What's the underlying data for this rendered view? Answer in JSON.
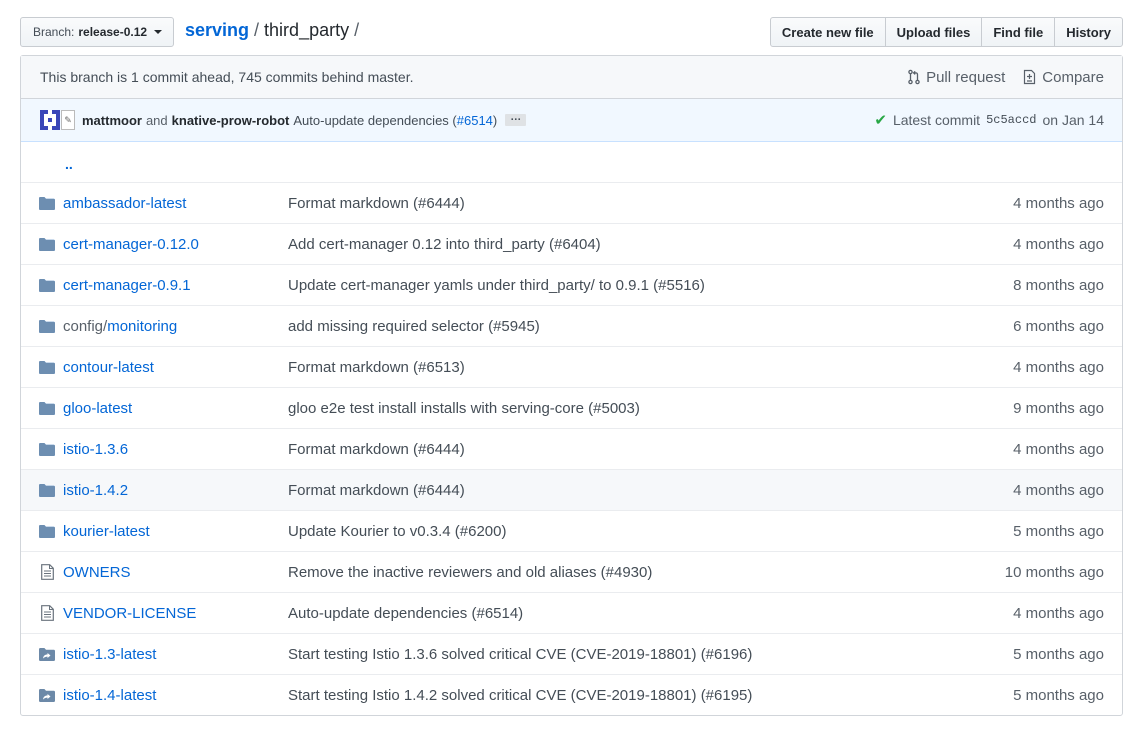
{
  "branch": {
    "prefix": "Branch:",
    "name": "release-0.12"
  },
  "breadcrumb": {
    "repo": "serving",
    "sep1": "/",
    "dir": "third_party",
    "sep2": "/"
  },
  "file_nav": {
    "create": "Create new file",
    "upload": "Upload files",
    "find": "Find file",
    "history": "History"
  },
  "branch_info": {
    "text": "This branch is 1 commit ahead, 745 commits behind master.",
    "pull_request": "Pull request",
    "compare": "Compare"
  },
  "commit": {
    "author1": "mattmoor",
    "and": "and",
    "author2": "knative-prow-robot",
    "message": "Auto-update dependencies (",
    "pr": "#6514",
    "message_end": ")",
    "ellipsis": "…",
    "latest_label": "Latest commit",
    "sha": "5c5accd",
    "date": "on Jan 14"
  },
  "parent_link": "..",
  "files": [
    {
      "type": "folder",
      "prefix": "",
      "name": "ambassador-latest",
      "message": "Format markdown (#6444)",
      "age": "4 months ago"
    },
    {
      "type": "folder",
      "prefix": "",
      "name": "cert-manager-0.12.0",
      "message": "Add cert-manager 0.12 into third_party (#6404)",
      "age": "4 months ago"
    },
    {
      "type": "folder",
      "prefix": "",
      "name": "cert-manager-0.9.1",
      "message": "Update cert-manager yamls under third_party/ to 0.9.1 (#5516)",
      "age": "8 months ago"
    },
    {
      "type": "folder",
      "prefix": "config/",
      "name": "monitoring",
      "message": "add missing required selector (#5945)",
      "age": "6 months ago"
    },
    {
      "type": "folder",
      "prefix": "",
      "name": "contour-latest",
      "message": "Format markdown (#6513)",
      "age": "4 months ago"
    },
    {
      "type": "folder",
      "prefix": "",
      "name": "gloo-latest",
      "message": "gloo e2e test install installs with serving-core (#5003)",
      "age": "9 months ago"
    },
    {
      "type": "folder",
      "prefix": "",
      "name": "istio-1.3.6",
      "message": "Format markdown (#6444)",
      "age": "4 months ago"
    },
    {
      "type": "folder",
      "prefix": "",
      "name": "istio-1.4.2",
      "message": "Format markdown (#6444)",
      "age": "4 months ago"
    },
    {
      "type": "folder",
      "prefix": "",
      "name": "kourier-latest",
      "message": "Update Kourier to v0.3.4 (#6200)",
      "age": "5 months ago"
    },
    {
      "type": "file",
      "prefix": "",
      "name": "OWNERS",
      "message": "Remove the inactive reviewers and old aliases (#4930)",
      "age": "10 months ago"
    },
    {
      "type": "file",
      "prefix": "",
      "name": "VENDOR-LICENSE",
      "message": "Auto-update dependencies (#6514)",
      "age": "4 months ago"
    },
    {
      "type": "symlink",
      "prefix": "",
      "name": "istio-1.3-latest",
      "message": "Start testing Istio 1.3.6 solved critical CVE (CVE-2019-18801) (#6196)",
      "age": "5 months ago"
    },
    {
      "type": "symlink",
      "prefix": "",
      "name": "istio-1.4-latest",
      "message": "Start testing Istio 1.4.2 solved critical CVE (CVE-2019-18801) (#6195)",
      "age": "5 months ago"
    }
  ],
  "colors": {
    "link": "#0366d6",
    "folder_icon": "#79b8ff",
    "check": "#28a745"
  }
}
